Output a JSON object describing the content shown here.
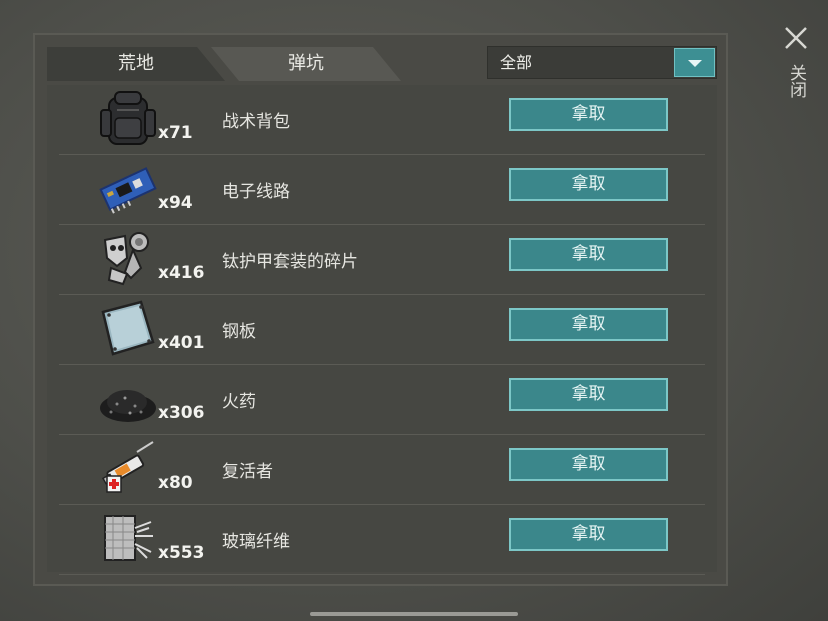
{
  "tabs": [
    {
      "label": "荒地",
      "active": true
    },
    {
      "label": "弹坑",
      "active": false
    }
  ],
  "filter": {
    "value": "全部",
    "dropdown_icon": "triangle-down-icon"
  },
  "close": {
    "label": "关闭",
    "icon": "close-icon"
  },
  "items": [
    {
      "name": "战术背包",
      "count": "x71",
      "button": "拿取",
      "icon": "backpack-icon"
    },
    {
      "name": "电子线路",
      "count": "x94",
      "button": "拿取",
      "icon": "circuit-board-icon"
    },
    {
      "name": "钛护甲套装的碎片",
      "count": "x416",
      "button": "拿取",
      "icon": "armor-fragments-icon"
    },
    {
      "name": "钢板",
      "count": "x401",
      "button": "拿取",
      "icon": "steel-plate-icon"
    },
    {
      "name": "火药",
      "count": "x306",
      "button": "拿取",
      "icon": "gunpowder-icon"
    },
    {
      "name": "复活者",
      "count": "x80",
      "button": "拿取",
      "icon": "reviver-syringe-icon"
    },
    {
      "name": "玻璃纤维",
      "count": "x553",
      "button": "拿取",
      "icon": "fiberglass-icon"
    }
  ],
  "colors": {
    "accent": "#3b878b",
    "panel": "#4a4a45"
  }
}
